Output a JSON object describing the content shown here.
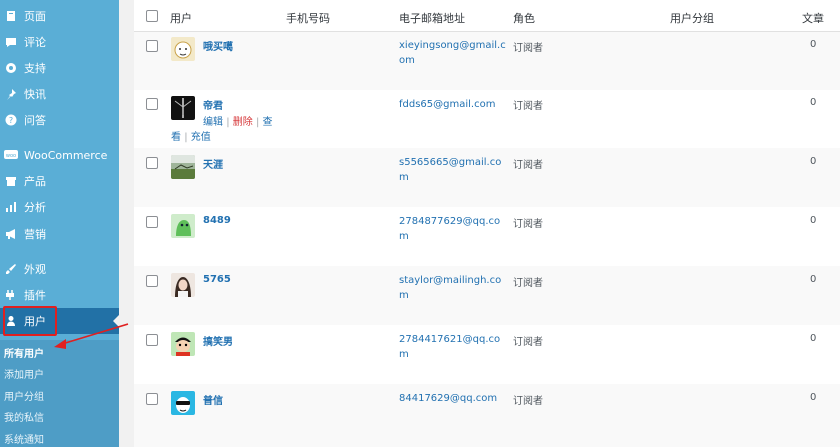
{
  "sidebar": {
    "items": [
      {
        "label": "页面",
        "icon": "pages-icon"
      },
      {
        "label": "评论",
        "icon": "comment-icon"
      },
      {
        "label": "支持",
        "icon": "support-icon"
      },
      {
        "label": "快讯",
        "icon": "pin-icon"
      },
      {
        "label": "问答",
        "icon": "question-icon"
      },
      {
        "label": "WooCommerce",
        "icon": "woo-icon"
      },
      {
        "label": "产品",
        "icon": "archive-icon"
      },
      {
        "label": "分析",
        "icon": "bar-chart-icon"
      },
      {
        "label": "营销",
        "icon": "megaphone-icon"
      },
      {
        "label": "外观",
        "icon": "brush-icon"
      },
      {
        "label": "插件",
        "icon": "plugin-icon"
      },
      {
        "label": "用户",
        "icon": "user-icon"
      }
    ],
    "submenu": [
      "所有用户",
      "添加用户",
      "用户分组",
      "我的私信",
      "系统通知"
    ]
  },
  "table": {
    "headers": {
      "user": "用户",
      "phone": "手机号码",
      "email": "电子邮箱地址",
      "role": "角色",
      "group": "用户分组",
      "posts": "文章"
    },
    "rows": [
      {
        "name": "哦买噶",
        "email": "xieyingsong@gmail.com",
        "role": "订阅者",
        "posts": "0"
      },
      {
        "name": "帝君",
        "email": "fdds65@gmail.com",
        "role": "订阅者",
        "posts": "0",
        "actions": {
          "edit": "编辑",
          "delete": "删除",
          "view_a": "查",
          "view_b": "看",
          "recharge": "充值",
          "sep": "|"
        }
      },
      {
        "name": "天涯",
        "email": "s5565665@gmail.com",
        "role": "订阅者",
        "posts": "0"
      },
      {
        "name": "8489",
        "email": "2784877629@qq.com",
        "role": "订阅者",
        "posts": "0"
      },
      {
        "name": "5765",
        "email": "staylor@mailingh.com",
        "role": "订阅者",
        "posts": "0"
      },
      {
        "name": "搞笑男",
        "email": "2784417621@qq.com",
        "role": "订阅者",
        "posts": "0"
      },
      {
        "name": "普信",
        "email": "84417629@qq.com",
        "role": "订阅者",
        "posts": "0"
      }
    ]
  },
  "colors": {
    "sidebar": "#5aaed6",
    "active": "#2271a6",
    "link": "#2271b1",
    "highlight": "#e02020"
  }
}
